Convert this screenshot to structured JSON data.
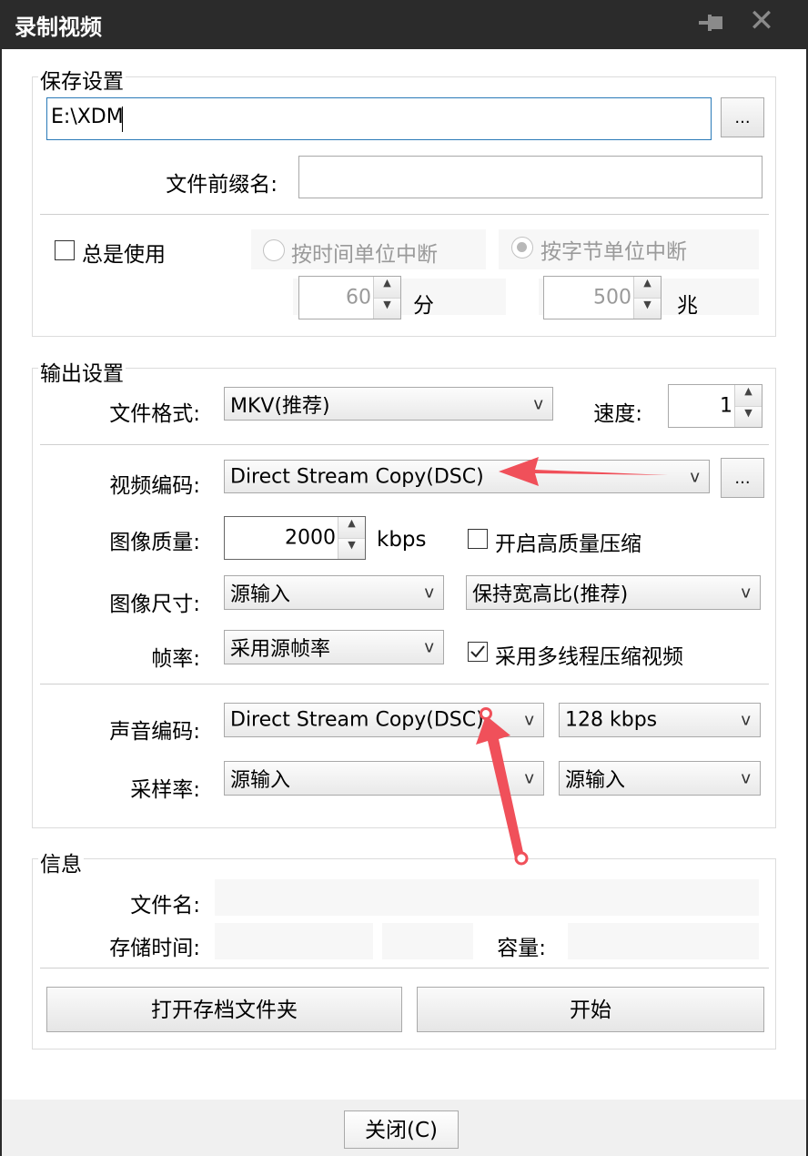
{
  "window": {
    "title": "录制视频",
    "close_glyph": "✕"
  },
  "save_settings": {
    "group_label": "保存设置",
    "path_value": "E:\\XDM",
    "browse_label": "...",
    "prefix_label": "文件前缀名:",
    "prefix_value": "",
    "always_use_label": "总是使用",
    "split_by_time_label": "按时间单位中断",
    "split_by_bytes_label": "按字节单位中断",
    "time_value": "60",
    "time_unit": "分",
    "bytes_value": "500",
    "bytes_unit": "兆"
  },
  "output_settings": {
    "group_label": "输出设置",
    "format_label": "文件格式:",
    "format_value": "MKV(推荐)",
    "speed_label": "速度:",
    "speed_value": "1",
    "video_codec_label": "视频编码:",
    "video_codec_value": "Direct Stream Copy(DSC)",
    "video_codec_more": "...",
    "quality_label": "图像质量:",
    "quality_value": "2000",
    "quality_unit": "kbps",
    "hq_compress_label": "开启高质量压缩",
    "size_label": "图像尺寸:",
    "size_value": "源输入",
    "aspect_value": "保持宽高比(推荐)",
    "fps_label": "帧率:",
    "fps_value": "采用源帧率",
    "multithread_label": "采用多线程压缩视频",
    "audio_codec_label": "声音编码:",
    "audio_codec_value": "Direct Stream Copy(DSC)",
    "audio_bitrate_value": "128 kbps",
    "sample_rate_label": "采样率:",
    "sample_rate_value": "源输入",
    "channels_value": "源输入"
  },
  "info": {
    "group_label": "信息",
    "filename_label": "文件名:",
    "duration_label": "存储时间:",
    "capacity_label": "容量:",
    "open_folder_label": "打开存档文件夹",
    "start_label": "开始"
  },
  "footer": {
    "close_label": "关闭(C)"
  },
  "combo_arrow": "v",
  "colors": {
    "titlebar": "#2b2b2b",
    "annotation_arrow": "#f0505a",
    "focus_border": "#2a7ab8"
  }
}
